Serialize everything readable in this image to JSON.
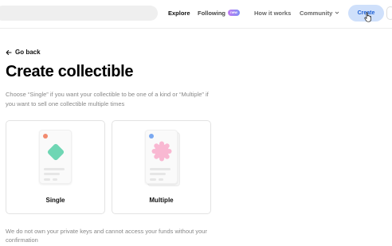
{
  "header": {
    "nav": {
      "explore": "Explore",
      "following": "Following",
      "following_badge": "new",
      "how_it_works": "How it works",
      "community": "Community",
      "create": "Create"
    }
  },
  "main": {
    "back_label": "Go back",
    "title": "Create collectible",
    "description": "Choose “Single” if you want your collectible to be one of a kind or “Multiple” if you want to sell one collectible multiple times",
    "options": [
      {
        "label": "Single",
        "dot_color": "#f28b6f",
        "shape_color": "#6fd6b4",
        "shape": "diamond"
      },
      {
        "label": "Multiple",
        "dot_color": "#7aa8f0",
        "shape_color": "#f9b8d2",
        "shape": "flower"
      }
    ],
    "footer_note": "We do not own your private keys and cannot access your funds without your confirmation"
  },
  "colors": {
    "accent": "#1d5fd4",
    "create_bg": "#cfe0fb"
  }
}
